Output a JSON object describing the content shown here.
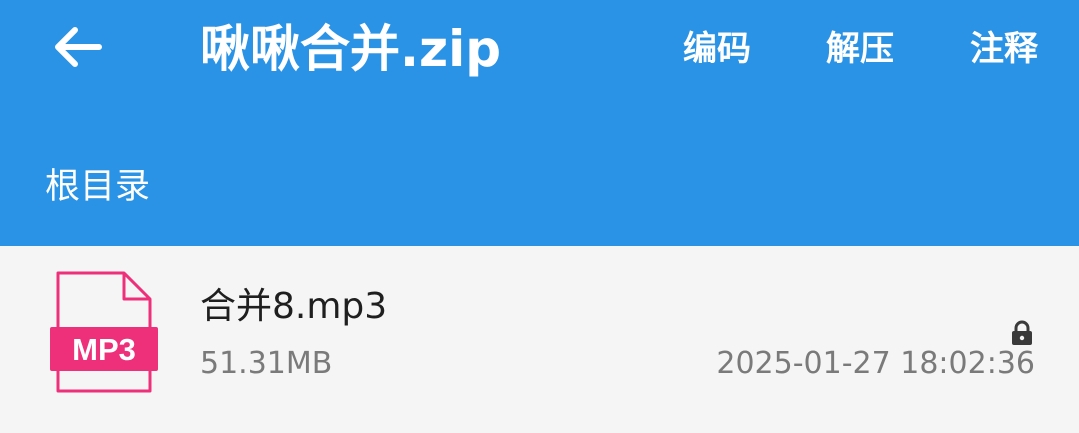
{
  "header": {
    "title": "啾啾合并.zip",
    "back_icon": "arrow-left-icon",
    "actions": {
      "encoding": "编码",
      "extract": "解压",
      "comment": "注释"
    },
    "breadcrumb": "根目录",
    "background_color": "#2a93e6"
  },
  "files": [
    {
      "name": "合并8.mp3",
      "size": "51.31MB",
      "modified": "2025-01-27 18:02:36",
      "type_badge": "MP3",
      "icon": "mp3-file-icon",
      "locked_icon": "lock-icon",
      "badge_color": "#ee2f7a"
    }
  ]
}
